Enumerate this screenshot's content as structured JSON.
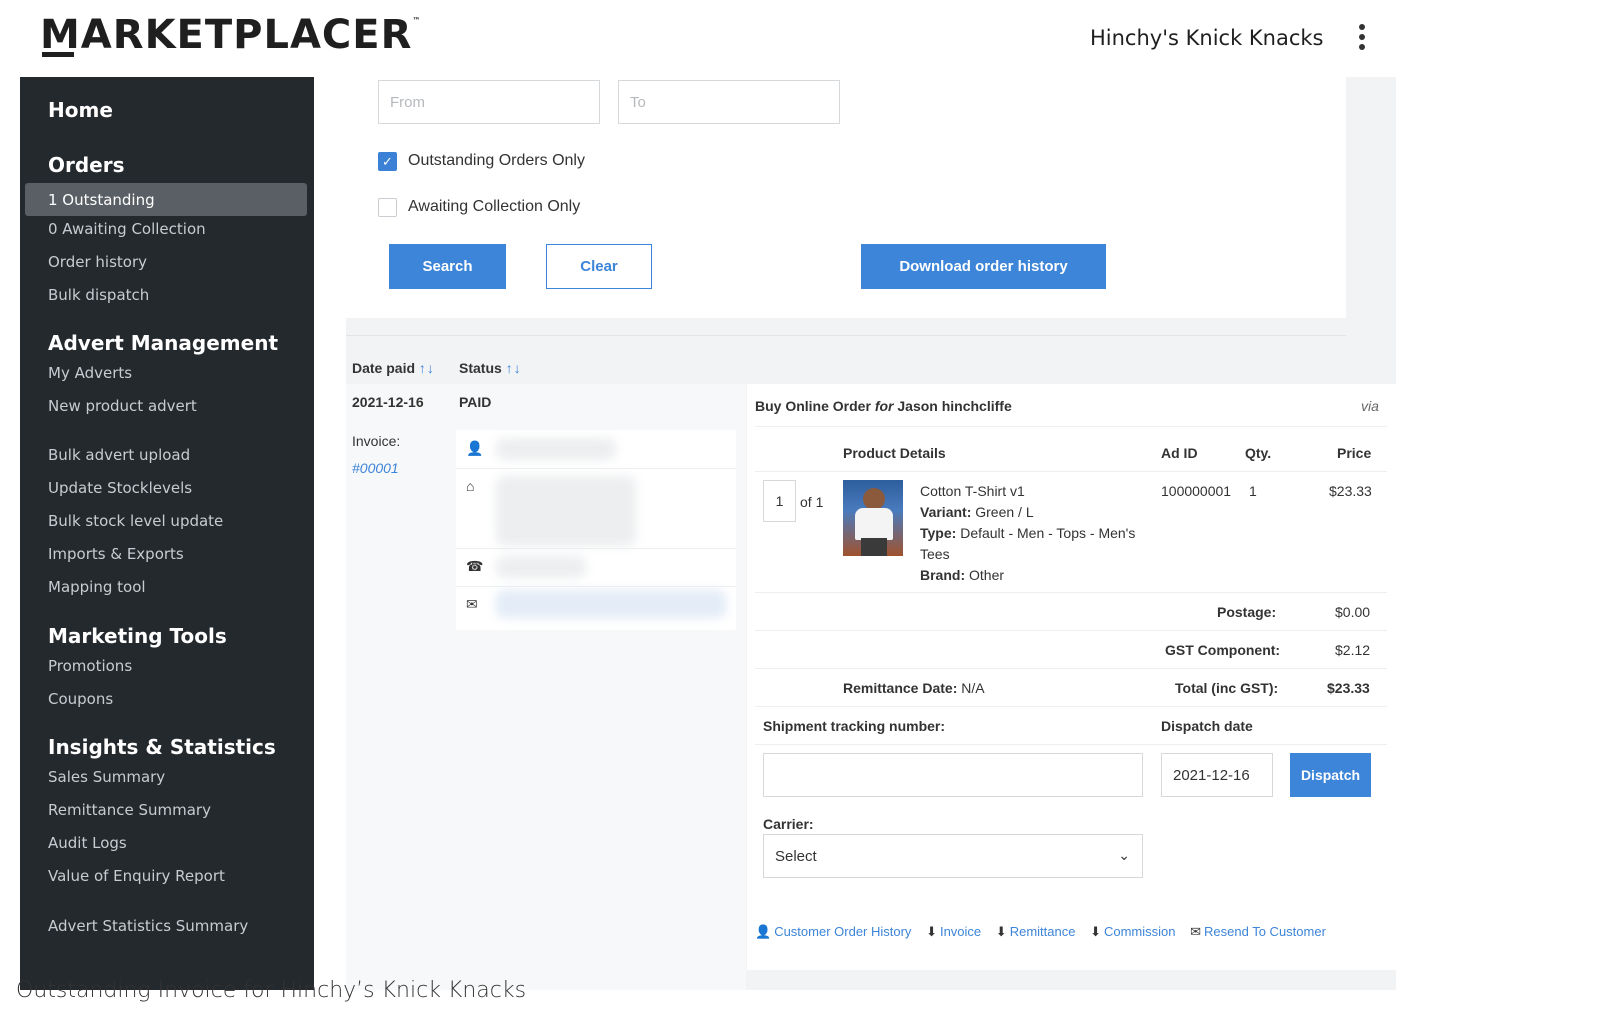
{
  "header": {
    "logo_text": "MARKETPLACER",
    "logo_tm": "™",
    "store_name": "Hinchy's Knick Knacks"
  },
  "sidebar": {
    "home": "Home",
    "orders_title": "Orders",
    "orders_items": [
      "1 Outstanding",
      "0 Awaiting Collection",
      "Order history",
      "Bulk dispatch"
    ],
    "advert_title": "Advert Management",
    "advert_items": [
      "My Adverts",
      "New product advert",
      "Bulk advert upload",
      "Update Stocklevels",
      "Bulk stock level update",
      "Imports & Exports",
      "Mapping tool"
    ],
    "marketing_title": "Marketing Tools",
    "marketing_items": [
      "Promotions",
      "Coupons"
    ],
    "insights_title": "Insights & Statistics",
    "insights_items": [
      "Sales Summary",
      "Remittance Summary",
      "Audit Logs",
      "Value of Enquiry Report",
      "Advert Statistics Summary"
    ]
  },
  "filters": {
    "from_placeholder": "From",
    "to_placeholder": "To",
    "outstanding_label": "Outstanding Orders Only",
    "outstanding_checked": true,
    "awaiting_label": "Awaiting Collection Only",
    "awaiting_checked": false,
    "search_label": "Search",
    "clear_label": "Clear",
    "download_label": "Download order history"
  },
  "table": {
    "date_paid_header": "Date paid",
    "status_header": "Status",
    "sort_arrows": "↑↓",
    "date_paid": "2021-12-16",
    "status": "PAID",
    "invoice_label": "Invoice:",
    "invoice_number": "#00001"
  },
  "order": {
    "title_prefix": "Buy Online Order",
    "title_for": "for",
    "customer": "Jason hinchcliffe",
    "via": "via",
    "col_product": "Product Details",
    "col_adid": "Ad ID",
    "col_qty": "Qty.",
    "col_price": "Price",
    "line_qty_value": "1",
    "line_of": "of 1",
    "product_name": "Cotton T-Shirt v1",
    "variant_label": "Variant:",
    "variant_value": "Green / L",
    "type_label": "Type:",
    "type_value_1": "Default - Men - Tops - Men's",
    "type_value_2": "Tees",
    "brand_label": "Brand:",
    "brand_value": "Other",
    "ad_id": "100000001",
    "qty": "1",
    "price": "$23.33",
    "postage_label": "Postage:",
    "postage_value": "$0.00",
    "gst_label": "GST Component:",
    "gst_value": "$2.12",
    "remittance_label": "Remittance Date:",
    "remittance_value": "N/A",
    "total_label": "Total (inc GST):",
    "total_value": "$23.33",
    "tracking_label": "Shipment tracking number:",
    "dispatch_date_label": "Dispatch date",
    "dispatch_date_value": "2021-12-16",
    "dispatch_button": "Dispatch",
    "carrier_label": "Carrier:",
    "carrier_value": "Select",
    "links": [
      "Customer Order History",
      "Invoice",
      "Remittance",
      "Commission",
      "Resend To Customer"
    ]
  },
  "caption": "Outstanding Invoice for Hinchy’s Knick Knacks",
  "colors": {
    "accent": "#3d85d8",
    "sidebar_bg": "#24292e",
    "sidebar_active": "#5a5f65"
  }
}
